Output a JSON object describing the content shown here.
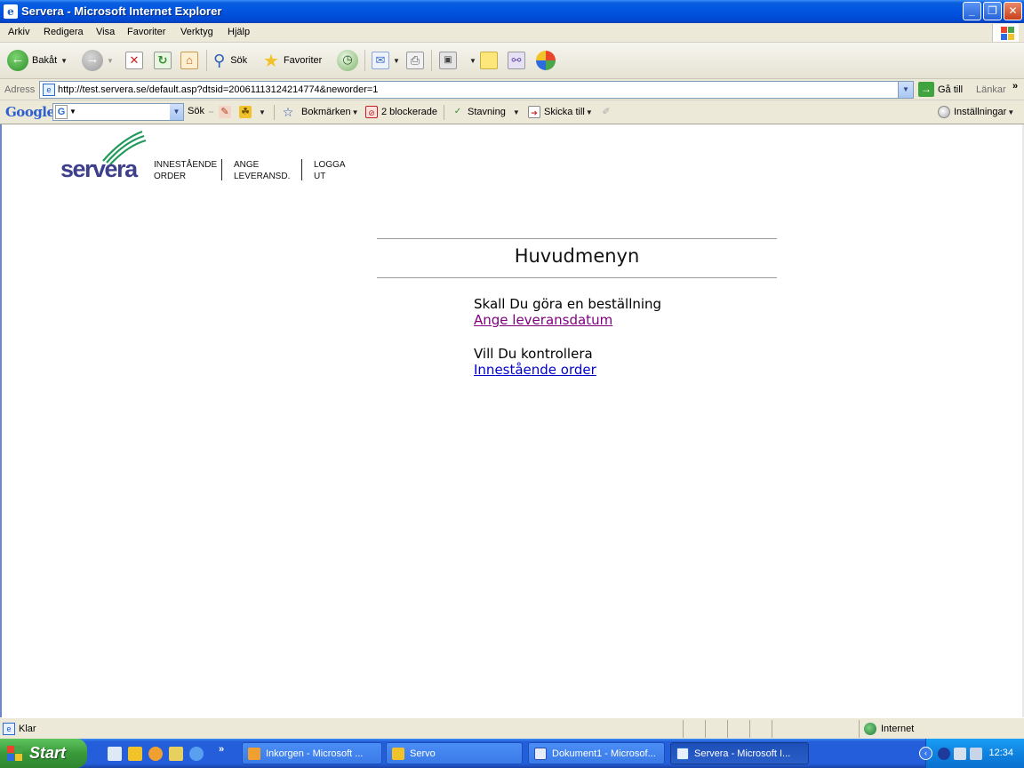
{
  "window": {
    "title": "Servera - Microsoft Internet Explorer",
    "buttons": {
      "minimize": "_",
      "maximize": "❐",
      "close": "✕"
    }
  },
  "menu": [
    "Arkiv",
    "Redigera",
    "Visa",
    "Favoriter",
    "Verktyg",
    "Hjälp"
  ],
  "toolbar": {
    "back": "Bakåt",
    "search": "Sök",
    "favorites": "Favoriter"
  },
  "address": {
    "label": "Adress",
    "url": "http://test.servera.se/default.asp?dtsid=20061113124214774&neworder=1",
    "go": "Gå till",
    "links": "Länkar",
    "more": "»"
  },
  "google_bar": {
    "logo": "Google",
    "search": "Sök",
    "bookmarks": "Bokmärken",
    "blocked": "2 blockerade",
    "spell": "Stavning",
    "send": "Skicka till",
    "settings": "Inställningar"
  },
  "site": {
    "logo": "servera",
    "nav": [
      {
        "line1": "INNESTÅENDE",
        "line2": "ORDER"
      },
      {
        "line1": "ANGE",
        "line2": "LEVERANSD."
      },
      {
        "line1": "LOGGA",
        "line2": "UT"
      }
    ],
    "heading": "Huvudmenyn",
    "sections": [
      {
        "prompt": "Skall Du göra en beställning",
        "link": "Ange leveransdatum",
        "link_color": "#800080"
      },
      {
        "prompt": "Vill Du kontrollera",
        "link": "Innestående order",
        "link_color": "#0000cc"
      }
    ]
  },
  "status": {
    "text": "Klar",
    "zone": "Internet"
  },
  "taskbar": {
    "start": "Start",
    "overflow": "»",
    "tasks": [
      {
        "label": "Inkorgen - Microsoft ...",
        "active": false
      },
      {
        "label": "Servo",
        "active": false
      },
      {
        "label": "Dokument1 - Microsof...",
        "active": false
      },
      {
        "label": "Servera - Microsoft I...",
        "active": true
      }
    ],
    "clock": "12:34"
  }
}
